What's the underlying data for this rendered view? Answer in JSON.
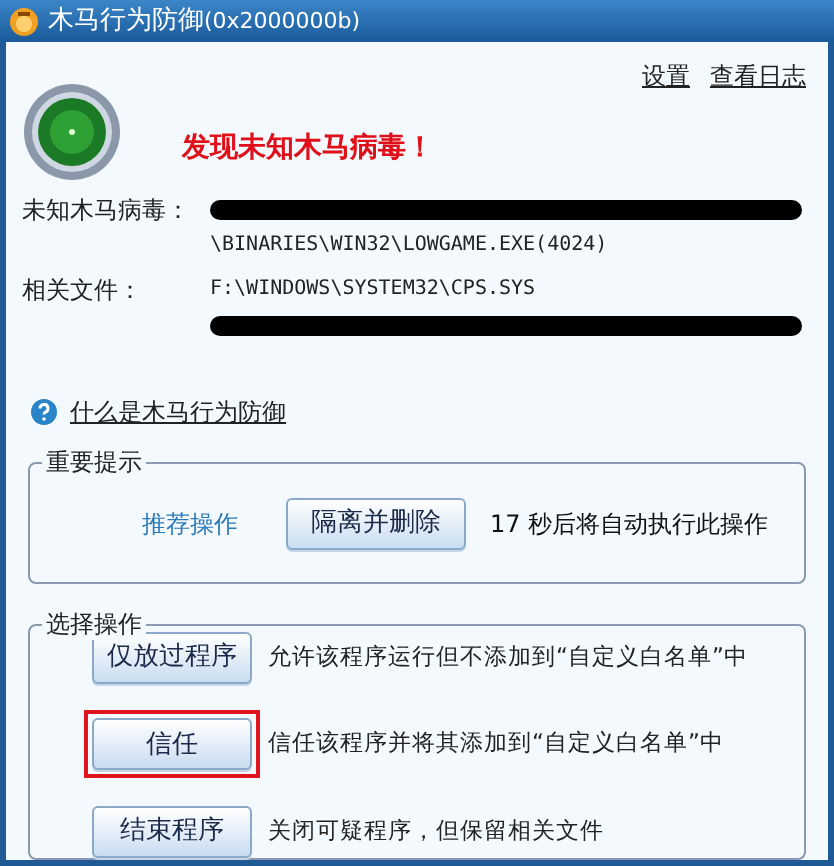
{
  "window": {
    "title": "木马行为防御",
    "code": "(0x2000000b)"
  },
  "links": [
    "设置",
    "查看日志"
  ],
  "alert": "发现未知木马病毒！",
  "details": [
    {
      "label": "未知木马病毒：",
      "lines": [
        {
          "kind": "redacted"
        },
        {
          "kind": "text",
          "text": "\\BINARIES\\WIN32\\LOWGAME.EXE(4024)"
        }
      ]
    },
    {
      "label": "相关文件：",
      "lines": [
        {
          "kind": "text",
          "text": "F:\\WINDOWS\\SYSTEM32\\CPS.SYS"
        },
        {
          "kind": "redacted"
        }
      ]
    }
  ],
  "help_link": "什么是木马行为防御",
  "important": {
    "title": "重要提示",
    "recommend_label": "推荐操作",
    "button": "隔离并删除",
    "countdown": "17 秒后将自动执行此操作"
  },
  "choose": {
    "title": "选择操作",
    "options": [
      {
        "button": "仅放过程序",
        "description": "允许该程序运行但不添加到“自定义白名单”中",
        "highlighted": false
      },
      {
        "button": "信任",
        "description": "信任该程序并将其添加到“自定义白名单”中",
        "highlighted": true
      },
      {
        "button": "结束程序",
        "description": "关闭可疑程序，但保留相关文件",
        "highlighted": false
      }
    ]
  }
}
